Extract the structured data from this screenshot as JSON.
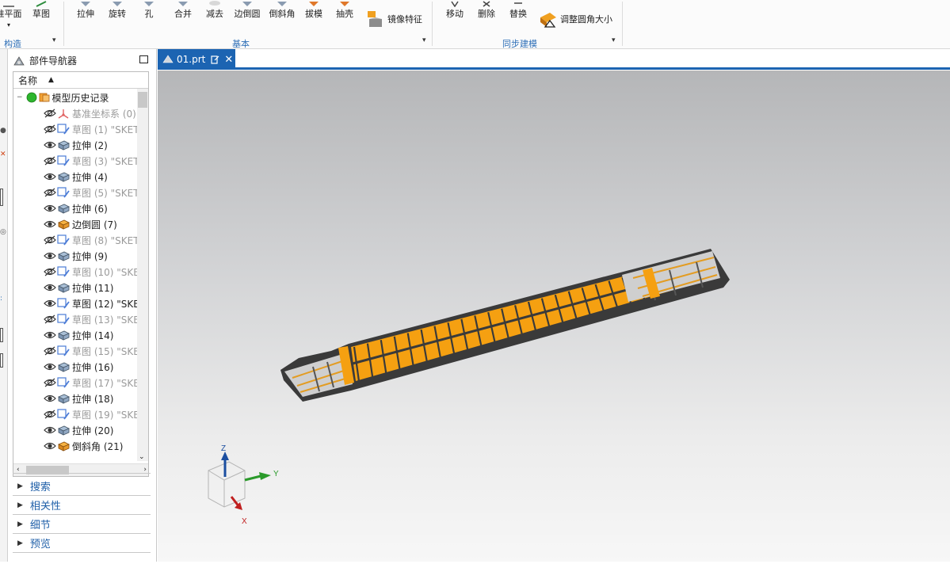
{
  "ribbon": {
    "buttons": [
      {
        "label": "准平面",
        "icon": "datum-plane-icon"
      },
      {
        "label": "草图",
        "icon": "sketch-icon"
      },
      {
        "label": "拉伸",
        "icon": "extrude-icon"
      },
      {
        "label": "旋转",
        "icon": "revolve-icon"
      },
      {
        "label": "孔",
        "icon": "hole-icon"
      },
      {
        "label": "合并",
        "icon": "unite-icon"
      },
      {
        "label": "减去",
        "icon": "subtract-icon"
      },
      {
        "label": "边倒圆",
        "icon": "edge-blend-icon"
      },
      {
        "label": "倒斜角",
        "icon": "chamfer-icon"
      },
      {
        "label": "拔模",
        "icon": "draft-icon"
      },
      {
        "label": "抽壳",
        "icon": "shell-icon"
      },
      {
        "label": "镜像特征",
        "icon": "mirror-feature-icon"
      },
      {
        "label": "移动",
        "icon": "move-face-icon"
      },
      {
        "label": "删除",
        "icon": "delete-face-icon"
      },
      {
        "label": "替换",
        "icon": "replace-face-icon"
      },
      {
        "label": "调整圆角大小",
        "icon": "resize-blend-icon"
      }
    ],
    "groups": [
      {
        "label": "构造"
      },
      {
        "label": "基本"
      },
      {
        "label": "同步建模"
      }
    ]
  },
  "navigator": {
    "title": "部件导航器",
    "column_name": "名称",
    "root": "模型历史记录",
    "items": [
      {
        "label": "基准坐标系 (0)",
        "dim": true,
        "type": "csys"
      },
      {
        "label": "草图 (1) \"SKET",
        "dim": true,
        "type": "sketch"
      },
      {
        "label": "拉伸 (2)",
        "dim": false,
        "type": "extrude"
      },
      {
        "label": "草图 (3) \"SKET",
        "dim": true,
        "type": "sketch"
      },
      {
        "label": "拉伸 (4)",
        "dim": false,
        "type": "extrude"
      },
      {
        "label": "草图 (5) \"SKET",
        "dim": true,
        "type": "sketch"
      },
      {
        "label": "拉伸 (6)",
        "dim": false,
        "type": "extrude"
      },
      {
        "label": "边倒圆 (7)",
        "dim": false,
        "type": "blend"
      },
      {
        "label": "草图 (8) \"SKET",
        "dim": true,
        "type": "sketch"
      },
      {
        "label": "拉伸 (9)",
        "dim": false,
        "type": "extrude"
      },
      {
        "label": "草图 (10) \"SKE",
        "dim": true,
        "type": "sketch"
      },
      {
        "label": "拉伸 (11)",
        "dim": false,
        "type": "extrude"
      },
      {
        "label": "草图 (12) \"SKE",
        "dim": false,
        "type": "sketch"
      },
      {
        "label": "草图 (13) \"SKE",
        "dim": true,
        "type": "sketch"
      },
      {
        "label": "拉伸 (14)",
        "dim": false,
        "type": "extrude"
      },
      {
        "label": "草图 (15) \"SKE",
        "dim": true,
        "type": "sketch"
      },
      {
        "label": "拉伸 (16)",
        "dim": false,
        "type": "extrude"
      },
      {
        "label": "草图 (17) \"SKE",
        "dim": true,
        "type": "sketch"
      },
      {
        "label": "拉伸 (18)",
        "dim": false,
        "type": "extrude"
      },
      {
        "label": "草图 (19) \"SKE",
        "dim": true,
        "type": "sketch"
      },
      {
        "label": "拉伸 (20)",
        "dim": false,
        "type": "extrude"
      },
      {
        "label": "倒斜角 (21)",
        "dim": false,
        "type": "chamfer"
      }
    ],
    "sections": [
      {
        "label": "搜索"
      },
      {
        "label": "相关性"
      },
      {
        "label": "细节"
      },
      {
        "label": "预览"
      }
    ]
  },
  "tab": {
    "label": "01.prt"
  },
  "triad": {
    "x": "X",
    "y": "Y",
    "z": "Z"
  },
  "colors": {
    "accent": "#1c64b2",
    "model": "#f5a011",
    "frame": "#3a3a3a"
  }
}
